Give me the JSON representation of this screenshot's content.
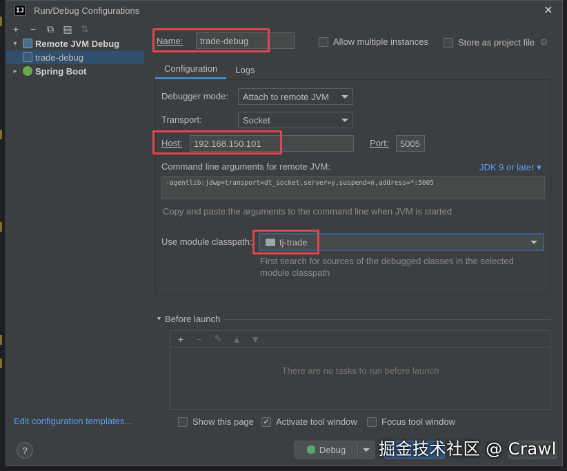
{
  "window": {
    "title": "Run/Debug Configurations",
    "app_icon_label": "IJ",
    "close_glyph": "✕"
  },
  "left_toolbar": {
    "icons": [
      "add-icon",
      "remove-icon",
      "copy-icon",
      "folder-icon",
      "sort-icon"
    ]
  },
  "tree": {
    "remote_group_label": "Remote JVM Debug",
    "remote_item_label": "trade-debug",
    "spring_group_label": "Spring Boot"
  },
  "edit_templates_label": "Edit configuration templates...",
  "config": {
    "name_label": "Name:",
    "name_value": "trade-debug",
    "allow_multiple_label": "Allow multiple instances",
    "allow_multiple_checked": false,
    "store_project_label": "Store as project file",
    "tabs": [
      "Configuration",
      "Logs"
    ],
    "active_tab": 0,
    "debugger_mode_label": "Debugger mode:",
    "debugger_mode_value": "Attach to remote JVM",
    "transport_label": "Transport:",
    "transport_value": "Socket",
    "host_label": "Host:",
    "host_value": "192.168.150.101",
    "port_label": "Port:",
    "port_value": "5005",
    "cmd_args_label": "Command line arguments for remote JVM:",
    "jdk_link": "JDK 9 or later",
    "cmd_args_value": "-agentlib:jdwp=transport=dt_socket,server=y,suspend=n,address=*:5005",
    "cmd_hint": "Copy and paste the arguments to the command line when JVM is started",
    "module_label": "Use module classpath:",
    "module_value": "tj-trade",
    "module_hint_line1": "First search for sources of the debugged classes in the selected",
    "module_hint_line2": "module classpath"
  },
  "before_launch": {
    "header": "Before launch",
    "empty_text": "There are no tasks to run before launch",
    "toolbar_icons": [
      "add-icon",
      "remove-icon",
      "edit-icon",
      "move-up-icon",
      "move-down-icon"
    ]
  },
  "options": {
    "show_page_label": "Show this page",
    "show_page_checked": false,
    "activate_tool_label": "Activate tool window",
    "activate_tool_checked": true,
    "focus_tool_label": "Focus tool window",
    "focus_tool_checked": false
  },
  "buttons": {
    "help_label": "?",
    "debug_label": "Debug"
  },
  "watermark": "掘金技术社区 @ Crawl",
  "colors": {
    "highlight": "#e0474c",
    "link": "#589df6",
    "selection": "#2f4f6a",
    "dialog_bg": "#3c3f41"
  }
}
